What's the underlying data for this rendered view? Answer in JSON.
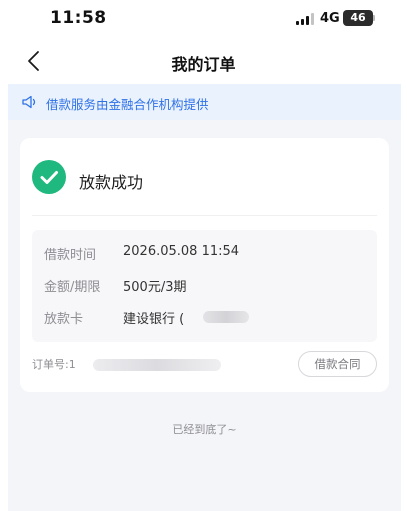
{
  "status_bar": {
    "time": "11:58",
    "network": "4G",
    "battery": "46"
  },
  "nav": {
    "title": "我的订单",
    "back_icon": "chevron-left-icon"
  },
  "notice": {
    "icon": "speaker-icon",
    "text": "借款服务由金融合作机构提供",
    "color": "#2f72e6",
    "background": "#eaf2fe"
  },
  "order": {
    "status_icon": "check-circle-icon",
    "status": "放款成功",
    "status_color": "#1fb87e",
    "details": [
      {
        "label": "借款时间",
        "value": "2026.05.08 11:54"
      },
      {
        "label": "金额/期限",
        "value": "500元/3期"
      },
      {
        "label": "放款卡",
        "value": "建设银行 ("
      }
    ],
    "order_no_label": "订单号:1",
    "contract_button": "借款合同"
  },
  "footer": {
    "end_text": "已经到底了~"
  }
}
